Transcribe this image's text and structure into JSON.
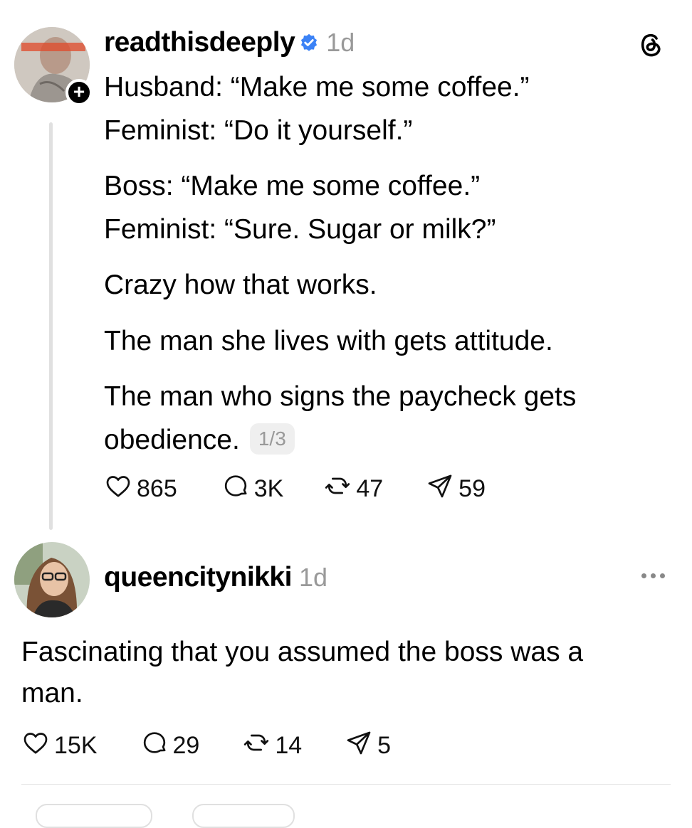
{
  "post": {
    "username": "readthisdeeply",
    "time": "1d",
    "lines": [
      "Husband: “Make me some coffee.”",
      "Feminist: “Do it yourself.”",
      "Boss: “Make me some coffee.”",
      "Feminist: “Sure. Sugar or milk?”",
      "Crazy how that works.",
      "The man she lives with gets attitude.",
      "The man who signs the paycheck gets",
      "obedience."
    ],
    "page_indicator": "1/3",
    "likes": "865",
    "replies": "3K",
    "reposts": "47",
    "shares": "59"
  },
  "reply": {
    "username": "queencitynikki",
    "time": "1d",
    "lines": [
      "Fascinating that you assumed the boss was a",
      "man."
    ],
    "likes": "15K",
    "replies": "29",
    "reposts": "14",
    "shares": "5"
  },
  "colors": {
    "verified": "#3b82f6",
    "muted": "#999999",
    "thread_line": "#e0e0e0"
  },
  "icons": [
    "threads-logo-icon",
    "verified-badge-icon",
    "heart-icon",
    "comment-icon",
    "repost-icon",
    "share-icon",
    "more-icon"
  ]
}
